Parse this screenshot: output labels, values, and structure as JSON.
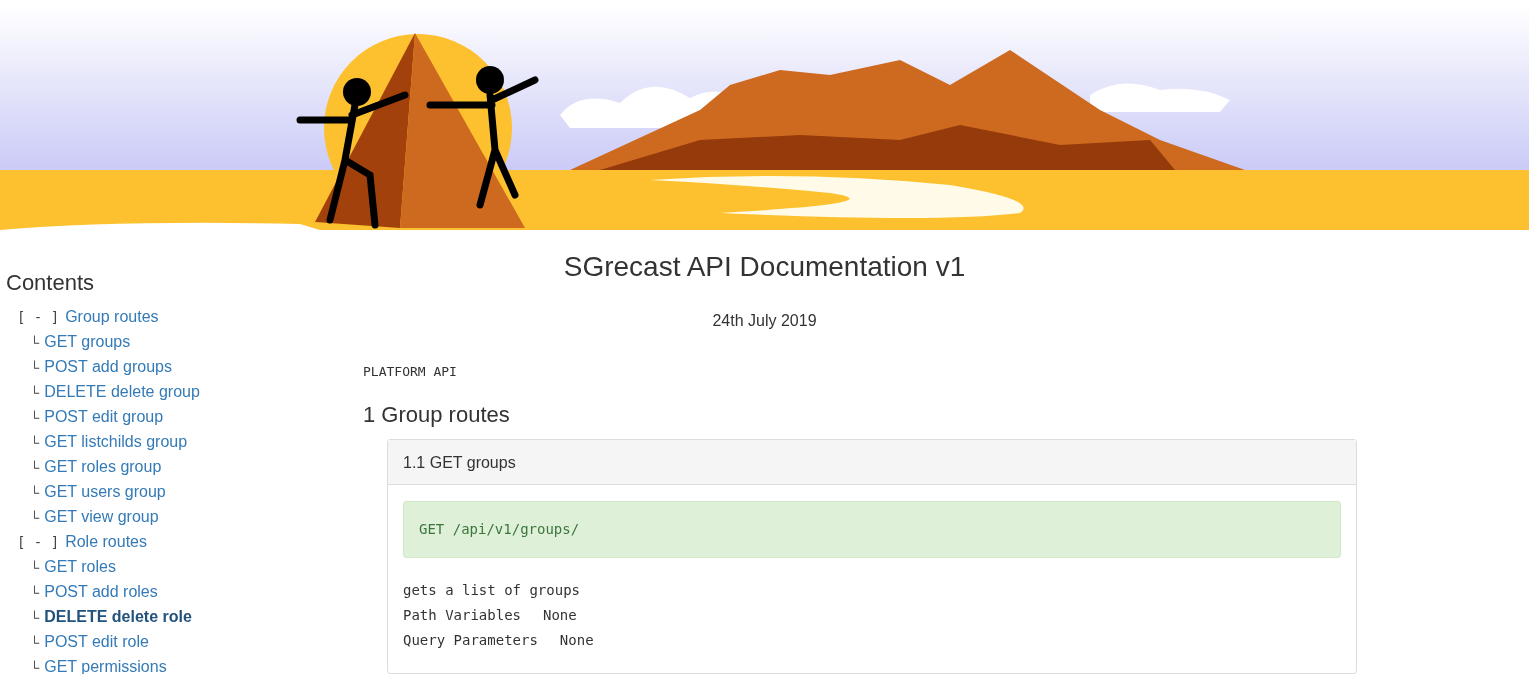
{
  "title": "SGrecast API Documentation v1",
  "date": "24th July 2019",
  "sidebar": {
    "heading": "Contents",
    "sections": [
      {
        "toggle": "[ - ]",
        "label": "Group routes",
        "children": [
          {
            "prefix": "└",
            "label": "GET groups",
            "selected": false
          },
          {
            "prefix": "└",
            "label": "POST add groups",
            "selected": false
          },
          {
            "prefix": "└",
            "label": "DELETE delete group",
            "selected": false
          },
          {
            "prefix": "└",
            "label": "POST edit group",
            "selected": false
          },
          {
            "prefix": "└",
            "label": "GET listchilds group",
            "selected": false
          },
          {
            "prefix": "└",
            "label": "GET roles group",
            "selected": false
          },
          {
            "prefix": "└",
            "label": "GET users group",
            "selected": false
          },
          {
            "prefix": "└",
            "label": "GET view group",
            "selected": false
          }
        ]
      },
      {
        "toggle": "[ - ]",
        "label": "Role routes",
        "children": [
          {
            "prefix": "└",
            "label": "GET roles",
            "selected": false
          },
          {
            "prefix": "└",
            "label": "POST add roles",
            "selected": false
          },
          {
            "prefix": "└",
            "label": "DELETE delete role",
            "selected": true
          },
          {
            "prefix": "└",
            "label": "POST edit role",
            "selected": false
          },
          {
            "prefix": "└",
            "label": "GET permissions",
            "selected": false
          }
        ]
      }
    ]
  },
  "main": {
    "label": "PLATFORM API",
    "sections": [
      {
        "heading": "1 Group routes",
        "endpoints": [
          {
            "title": "1.1 GET groups",
            "route": "GET /api/v1/groups/",
            "description": "gets a list of groups",
            "params": [
              {
                "name": "Path Variables",
                "value": "None"
              },
              {
                "name": "Query Parameters",
                "value": "None"
              }
            ]
          }
        ]
      }
    ]
  }
}
